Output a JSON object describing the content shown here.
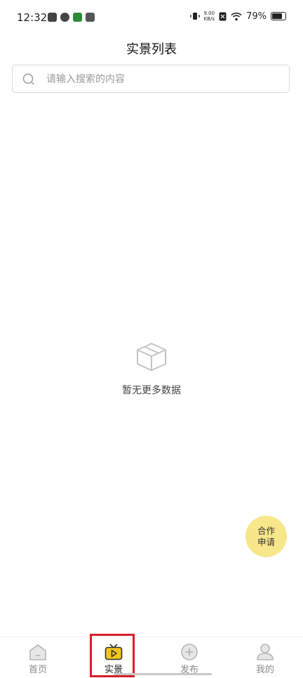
{
  "status_bar": {
    "time": "12:32",
    "net_speed_value": "9.00",
    "net_speed_unit": "KB/s",
    "battery_percent": "79%"
  },
  "header": {
    "title": "实景列表"
  },
  "search": {
    "placeholder": "请输入搜索的内容",
    "value": ""
  },
  "empty_state": {
    "message": "暂无更多数据",
    "icon": "box-icon"
  },
  "floating_button": {
    "line1": "合作",
    "line2": "申请"
  },
  "tab_bar": {
    "items": [
      {
        "label": "首页",
        "icon": "home-icon"
      },
      {
        "label": "实景",
        "icon": "tv-play-icon"
      },
      {
        "label": "发布",
        "icon": "plus-circle-icon"
      },
      {
        "label": "我的",
        "icon": "user-icon"
      }
    ],
    "active_index": 1
  },
  "colors": {
    "accent_yellow": "#f8e68a",
    "tab_active_yellow": "#f5c518",
    "highlight_red": "#d81e2c"
  }
}
